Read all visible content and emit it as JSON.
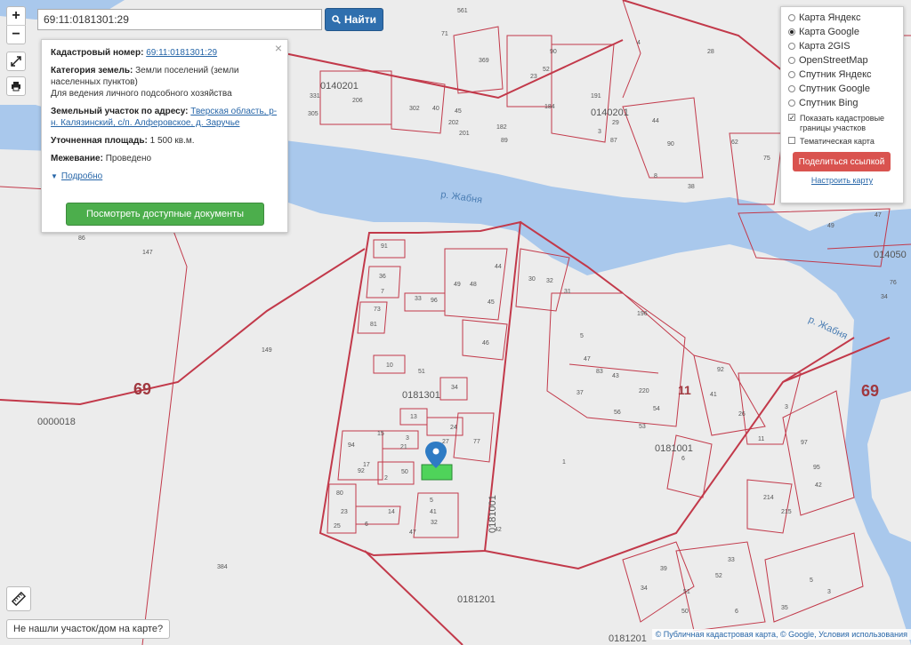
{
  "search": {
    "value": "69:11:0181301:29",
    "button_label": "Найти"
  },
  "zoom": {
    "in_label": "+",
    "out_label": "−"
  },
  "info_panel": {
    "cadastral_label": "Кадастровый номер:",
    "cadastral_value": "69:11:0181301:29",
    "category_label": "Категория земель:",
    "category_value": "Земли поселений (земли населенных пунктов)",
    "use_value": "Для ведения личного подсобного хозяйства",
    "address_label": "Земельный участок по адресу:",
    "address_value": "Тверская область, р-н. Калязинский, с/п. Алферовское, д. Заручье",
    "area_label": "Уточненная площадь:",
    "area_value": "1 500 кв.м.",
    "survey_label": "Межевание:",
    "survey_value": "Проведено",
    "more_label": "Подробно",
    "docs_button": "Посмотреть доступные документы"
  },
  "layers": {
    "items": [
      {
        "label": "Карта Яндекс",
        "selected": false
      },
      {
        "label": "Карта Google",
        "selected": true
      },
      {
        "label": "Карта 2GIS",
        "selected": false
      },
      {
        "label": "OpenStreetMap",
        "selected": false
      },
      {
        "label": "Спутник Яндекс",
        "selected": false
      },
      {
        "label": "Спутник Google",
        "selected": false
      },
      {
        "label": "Спутник Bing",
        "selected": false
      }
    ],
    "show_borders": "Показать кадастровые границы участков",
    "thematic": "Тематическая карта",
    "share_button": "Поделиться ссылкой",
    "setup_link": "Настроить карту"
  },
  "not_found": "Не нашли участок/дом на карте?",
  "attribution": "© Публичная кадастровая карта, © Google, Условия использования",
  "map": {
    "river_labels": [
      "р. Жабня",
      "р. Жабня"
    ],
    "region_labels": [
      "69",
      "69",
      "11"
    ],
    "quarter_labels": [
      "0140201",
      "0140201",
      "0181301",
      "0181001",
      "0181001",
      "0181201",
      "0000018",
      "014050",
      "0181201"
    ],
    "parcel_labels": [
      "91",
      "36",
      "7",
      "73",
      "81",
      "10",
      "51",
      "34",
      "33",
      "96",
      "49",
      "48",
      "44",
      "45",
      "46",
      "30",
      "32",
      "31",
      "13",
      "24",
      "27",
      "77",
      "3",
      "15",
      "94",
      "92",
      "17",
      "21",
      "50",
      "2",
      "5",
      "41",
      "32",
      "47",
      "80",
      "23",
      "25",
      "6",
      "14",
      "149",
      "147",
      "86",
      "384",
      "206",
      "331",
      "305",
      "302",
      "40",
      "45",
      "202",
      "201",
      "182",
      "89",
      "23",
      "52",
      "90",
      "184",
      "191",
      "3",
      "87",
      "29",
      "44",
      "90",
      "8",
      "38",
      "62",
      "75",
      "47",
      "49",
      "76",
      "34",
      "196",
      "5",
      "47",
      "83",
      "43",
      "220",
      "37",
      "56",
      "54",
      "53",
      "41",
      "92",
      "26",
      "3",
      "11",
      "97",
      "95",
      "42",
      "214",
      "215",
      "33",
      "52",
      "51",
      "50",
      "5",
      "3",
      "34",
      "35",
      "6",
      "39",
      "28",
      "4",
      "561",
      "369",
      "71",
      "6",
      "42",
      "1",
      "2",
      "49",
      "49"
    ]
  },
  "colors": {
    "water": "#a9c8ec",
    "border": "#c2394a",
    "land": "#ececec",
    "selected_parcel": "#4fd35a",
    "marker": "#2e7bc4"
  }
}
